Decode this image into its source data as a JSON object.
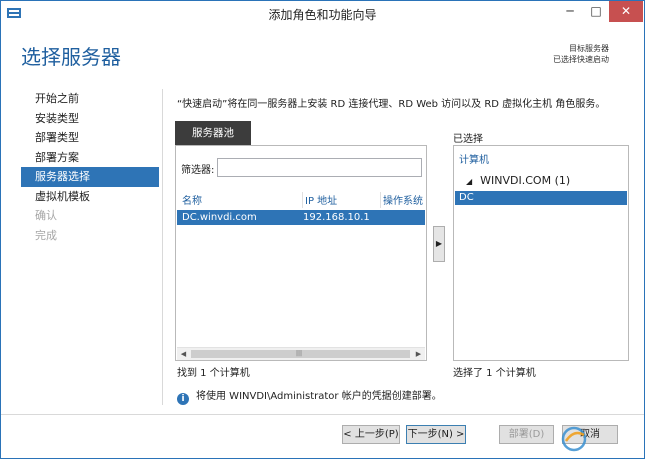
{
  "window": {
    "title": "添加角色和功能向导",
    "controls": {
      "minimize": "─",
      "maximize": "□",
      "close": "✕"
    }
  },
  "header": {
    "title": "选择服务器",
    "destination_label": "目标服务器",
    "destination_value": "已选择快速启动"
  },
  "nav": {
    "items": [
      {
        "label": "开始之前",
        "state": "normal"
      },
      {
        "label": "安装类型",
        "state": "normal"
      },
      {
        "label": "部署类型",
        "state": "normal"
      },
      {
        "label": "部署方案",
        "state": "normal"
      },
      {
        "label": "服务器选择",
        "state": "active"
      },
      {
        "label": "虚拟机模板",
        "state": "normal"
      },
      {
        "label": "确认",
        "state": "disabled"
      },
      {
        "label": "完成",
        "state": "disabled"
      }
    ]
  },
  "main": {
    "intro": "“快速启动”将在同一服务器上安装 RD 连接代理、RD Web 访问以及 RD 虚拟化主机 角色服务。",
    "server_pool": {
      "tab_label": "服务器池",
      "filter_label": "筛选器:",
      "filter_value": "",
      "columns": [
        "名称",
        "IP 地址",
        "操作系统"
      ],
      "rows": [
        {
          "name": "DC.winvdi.com",
          "ip": "192.168.10.1",
          "os": ""
        }
      ],
      "found_count": "找到 1 个计算机"
    },
    "add_button": "▶",
    "selected": {
      "title": "已选择",
      "column": "计算机",
      "group": "WINVDI.COM (1)",
      "items": [
        "DC"
      ],
      "count": "选择了 1 个计算机"
    },
    "info": "将使用 WINVDI\\Administrator 帐户的凭据创建部署。"
  },
  "footer": {
    "prev": "< 上一步(P)",
    "next": "下一步(N) >",
    "deploy": "部署(D)",
    "cancel": "取消"
  },
  "colors": {
    "accent": "#2e74b6",
    "title_blue": "#1f5f9f",
    "close_red": "#c75050"
  }
}
